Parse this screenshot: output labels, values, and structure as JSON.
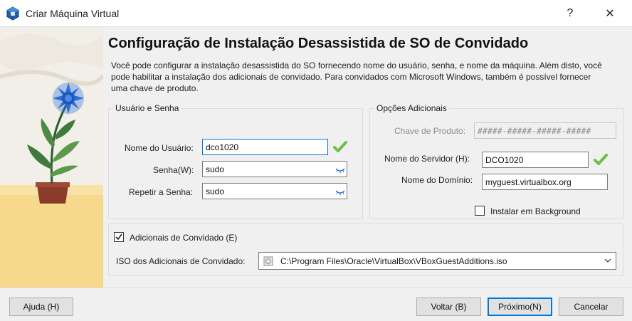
{
  "window": {
    "title": "Criar Máquina Virtual",
    "help_glyph": "?",
    "close_glyph": "✕",
    "app_icon": "virtualbox-icon"
  },
  "page": {
    "heading": "Configuração de Instalação Desassistida de SO de Convidado",
    "description": "Você pode configurar a instalação desassistida do SO fornecendo nome do usuário, senha, e nome da máquina. Além disto, você pode habilitar a instalação dos adicionais de convidado. Para convidados com Microsoft Windows, também é possível fornecer uma chave de produto."
  },
  "user_group": {
    "title": "Usuário e Senha",
    "username_label": "Nome do Usuário:",
    "username_value": "dco1020",
    "password_label": "Senha(W):",
    "password_value": "sudo",
    "repeat_label": "Repetir a Senha:",
    "repeat_value": "sudo"
  },
  "options_group": {
    "title": "Opções Adicionais",
    "product_key_label": "Chave de Produto:",
    "product_key_value": "#####-#####-#####-#####",
    "hostname_label": "Nome do Servidor (H):",
    "hostname_value": "DCO1020",
    "domain_label": "Nome do Domínio:",
    "domain_value": "myguest.virtualbox.org",
    "background_label": "Instalar em Background",
    "background_checked": false
  },
  "additions_group": {
    "title": "Adicionais de Convidado (E)",
    "checked": true,
    "iso_label": "ISO dos Adicionais de Convidado:",
    "iso_value": "C:\\Program Files\\Oracle\\VirtualBox\\VBoxGuestAdditions.iso"
  },
  "buttons": {
    "help": "Ajuda (H)",
    "back": "Voltar (B)",
    "next": "Próximo(N)",
    "cancel": "Cancelar"
  },
  "colors": {
    "accent": "#0078d7",
    "check_green": "#6cc04a",
    "flower_blue": "#2a6fd6"
  }
}
